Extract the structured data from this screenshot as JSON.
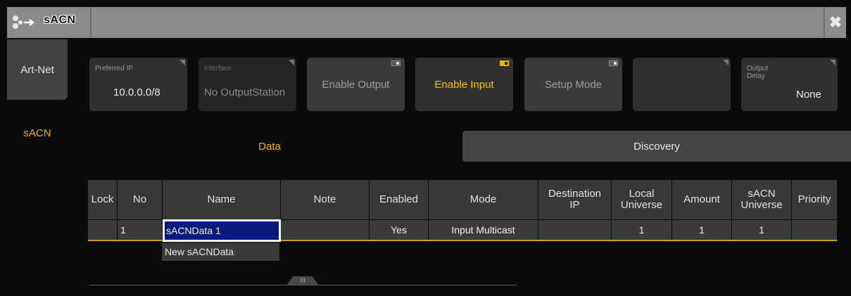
{
  "window": {
    "title": "sACN",
    "icon": "network-arrow-icon",
    "close_icon": "close-x-icon"
  },
  "sidebar": {
    "tabs": [
      {
        "label": "Art-Net",
        "active": false
      },
      {
        "label": "sACN",
        "active": true
      }
    ]
  },
  "toolbar": {
    "preferred_ip": {
      "label": "Preferred IP",
      "value": "10.0.0.0/8"
    },
    "interface": {
      "label": "Interface",
      "value": "No OutputStation"
    },
    "enable_output": {
      "label": "Enable Output",
      "state": "off"
    },
    "enable_input": {
      "label": "Enable Input",
      "state": "on"
    },
    "setup_mode": {
      "label": "Setup Mode",
      "state": "off"
    },
    "empty": {
      "label": ""
    },
    "output_delay": {
      "label": "Output\nDelay",
      "value": "None"
    }
  },
  "subtabs": {
    "data": "Data",
    "discovery": "Discovery",
    "active": "Data"
  },
  "table": {
    "columns": [
      "Lock",
      "No",
      "Name",
      "Note",
      "Enabled",
      "Mode",
      "Destination\nIP",
      "Local\nUniverse",
      "Amount",
      "sACN\nUniverse",
      "Priority"
    ],
    "rows": [
      {
        "lock": "",
        "no": "1",
        "name": "sACNData 1",
        "note": "",
        "enabled": "Yes",
        "mode": "Input Multicast",
        "destination_ip": "",
        "local_universe": "1",
        "amount": "1",
        "sacn_universe": "1",
        "priority": ""
      }
    ],
    "new_row_label": "New sACNData"
  },
  "scrollbar": {
    "handle_glyph": "III"
  },
  "colors": {
    "accent": "#f0b000",
    "selection": "#0a1a7a",
    "titlebar": "#8b8b8b"
  }
}
